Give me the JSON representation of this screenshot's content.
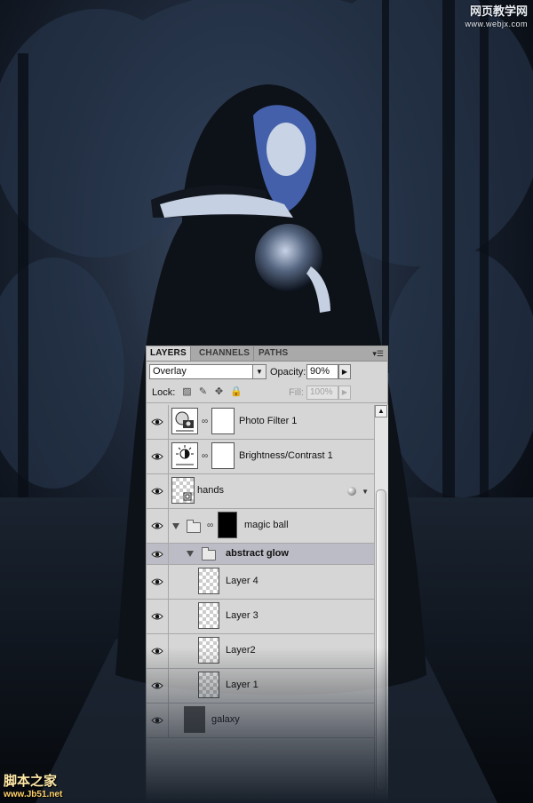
{
  "watermarks": {
    "top_cn": "网页教学网",
    "top_url": "www.webjx.com",
    "bottom_cn": "脚本之家",
    "bottom_url": "www.Jb51.net"
  },
  "panel": {
    "tabs": [
      {
        "label": "LAYERS",
        "active": true
      },
      {
        "label": "CHANNELS",
        "active": false
      },
      {
        "label": "PATHS",
        "active": false
      }
    ],
    "menu_icon": "panel-menu-icon",
    "blend_mode": "Overlay",
    "opacity_label": "Opacity:",
    "opacity_value": "90%",
    "lock_label": "Lock:",
    "fill_label": "Fill:",
    "fill_value": "100%",
    "lock_icons": [
      "lock-transparent-icon",
      "lock-image-icon",
      "lock-position-icon",
      "lock-all-icon"
    ]
  },
  "layers": [
    {
      "name": "Photo Filter 1",
      "type": "adjustment",
      "icon": "photo-filter-icon",
      "visible": true
    },
    {
      "name": "Brightness/Contrast 1",
      "type": "adjustment",
      "icon": "brightness-contrast-icon",
      "visible": true
    },
    {
      "name": "hands",
      "type": "smart",
      "visible": true,
      "has_style": true
    },
    {
      "name": "magic ball",
      "type": "group",
      "expanded": true,
      "visible": true
    },
    {
      "name": "abstract glow",
      "type": "group",
      "expanded": true,
      "visible": true,
      "selected": true
    },
    {
      "name": "Layer 4",
      "type": "pixel",
      "visible": true
    },
    {
      "name": "Layer 3",
      "type": "pixel",
      "visible": true
    },
    {
      "name": "Layer2",
      "type": "pixel",
      "visible": true
    },
    {
      "name": "Layer 1",
      "type": "pixel",
      "visible": true
    },
    {
      "name": "galaxy",
      "type": "pixel",
      "visible": true
    }
  ],
  "colors": {
    "panel_bg": "#d6d6d6",
    "selected_row": "#bcbcc6",
    "scene_bg": "#0c121b",
    "hair_accent": "#7a98e0"
  }
}
